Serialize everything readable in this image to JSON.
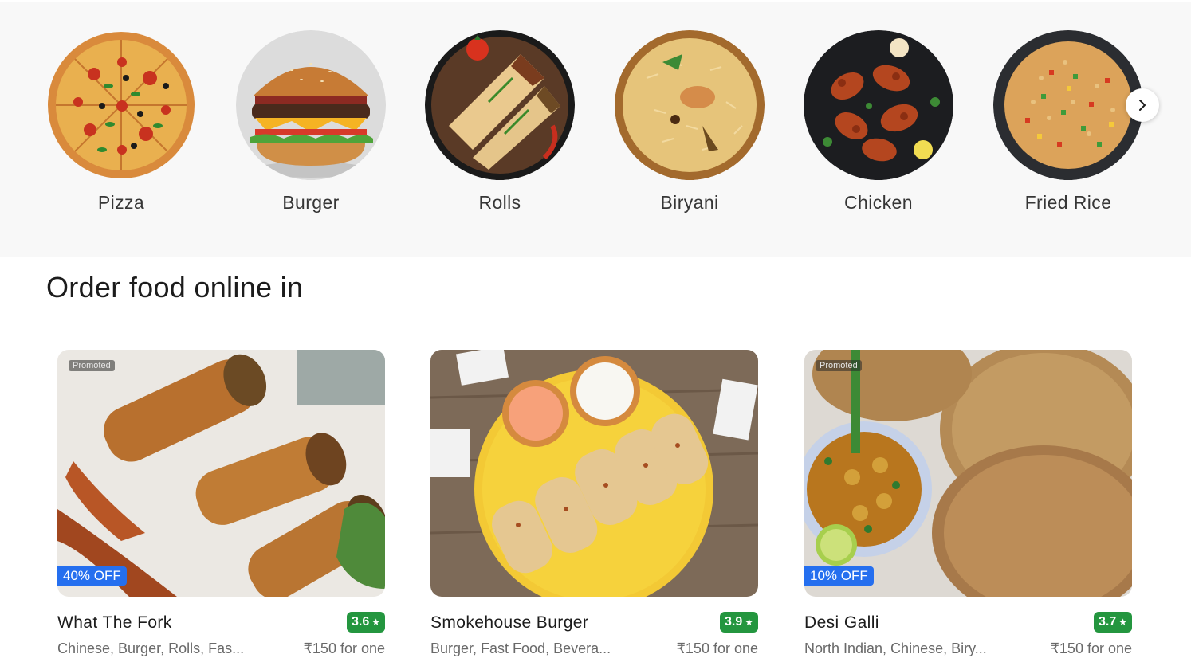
{
  "categories": [
    {
      "label": "Pizza",
      "icon": "pizza-image"
    },
    {
      "label": "Burger",
      "icon": "burger-image"
    },
    {
      "label": "Rolls",
      "icon": "rolls-image"
    },
    {
      "label": "Biryani",
      "icon": "biryani-image"
    },
    {
      "label": "Chicken",
      "icon": "chicken-image"
    },
    {
      "label": "Fried Rice",
      "icon": "fried-rice-image"
    }
  ],
  "next_icon": "chevron-right-icon",
  "section_title": "Order food online in",
  "restaurants": [
    {
      "name": "What The Fork",
      "rating": "3.6",
      "cuisine": "Chinese, Burger, Rolls, Fas...",
      "price": "₹150 for one",
      "promoted": "Promoted",
      "offer": "40% OFF"
    },
    {
      "name": "Smokehouse Burger",
      "rating": "3.9",
      "cuisine": "Burger, Fast Food, Bevera...",
      "price": "₹150 for one",
      "promoted": "",
      "offer": ""
    },
    {
      "name": "Desi Galli",
      "rating": "3.7",
      "cuisine": "North Indian, Chinese, Biry...",
      "price": "₹150 for one",
      "promoted": "Promoted",
      "offer": "10% OFF"
    }
  ],
  "colors": {
    "rating_bg": "#24963f",
    "offer_bg": "#256fef",
    "band_bg": "#f8f8f8"
  }
}
